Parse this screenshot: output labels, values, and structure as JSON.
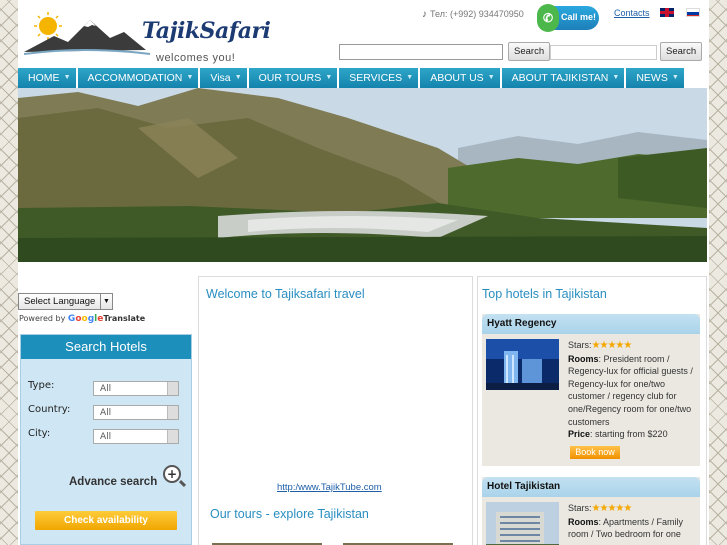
{
  "header": {
    "logo_text": "TajikSafari",
    "logo_sub": "welcomes you!",
    "phone": "Тел: (+992) 934470950",
    "callme_label": "Call me!",
    "contacts_label": "Contacts",
    "search_button_label": "Search",
    "search_button2_label": "Search",
    "icons": [
      "phone-icon",
      "call-icon",
      "flag-en-icon",
      "flag-ru-icon"
    ]
  },
  "nav": {
    "items": [
      {
        "label": "HOME"
      },
      {
        "label": "ACCOMMODATION"
      },
      {
        "label": "Visa"
      },
      {
        "label": "OUR TOURS"
      },
      {
        "label": "SERVICES"
      },
      {
        "label": "ABOUT US"
      },
      {
        "label": "ABOUT TAJIKISTAN"
      },
      {
        "label": "NEWS"
      }
    ]
  },
  "translate": {
    "select_label": "Select Language",
    "powered_by": "Powered by",
    "google": "Google",
    "translate_label": "Translate"
  },
  "search_hotels": {
    "title": "Search Hotels",
    "type_label": "Type:",
    "type_value": "All",
    "country_label": "Country:",
    "country_value": "All",
    "city_label": "City:",
    "city_value": "All",
    "advance_search_label": "Advance search",
    "check_button_label": "Check availability"
  },
  "main": {
    "welcome_title": "Welcome to Tajiksafari travel",
    "tube_link": "http:/www.TajikTube.com",
    "tours_title": "Our tours - explore Tajikistan"
  },
  "top_hotels": {
    "title": "Top hotels in Tajikistan",
    "hotels": [
      {
        "name": "Hyatt Regency",
        "stars_label": "Stars:",
        "stars": "★★★★★",
        "rooms_label": "Rooms",
        "rooms": ": President room / Regency-lux for official guests / Regency-lux for one/two customer / regency club for one/Regency room for one/two customers",
        "price_label": "Price",
        "price": ": starting from $220",
        "book_label": "Book now"
      },
      {
        "name": "Hotel Tajikistan",
        "stars_label": "Stars:",
        "stars": "★★★★★",
        "rooms_label": "Rooms",
        "rooms": ": Apartments / Family room / Two bedroom for one"
      }
    ]
  },
  "colors": {
    "nav": "#1d8fbb",
    "accent_title": "#2a8ec0",
    "button_orange": "#f0a600",
    "panel_bg": "#cfe6f4"
  }
}
